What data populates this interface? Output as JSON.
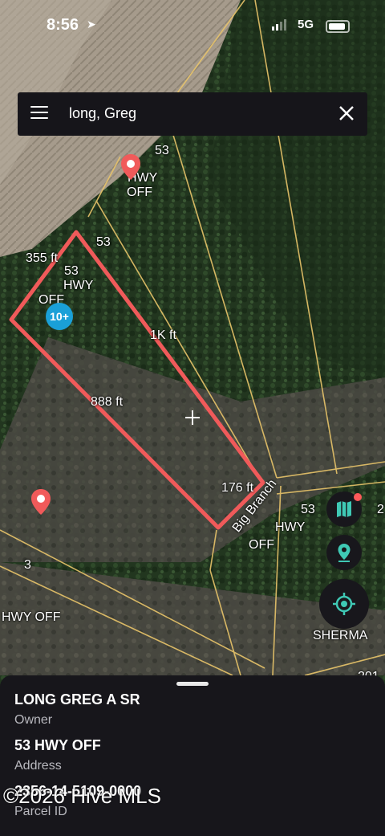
{
  "status_bar": {
    "time": "8:56",
    "network": "5G"
  },
  "search": {
    "query": "long, Greg"
  },
  "map": {
    "labels": {
      "lbl_53_top": "53",
      "lbl_hwy_top": "HWY",
      "lbl_off_top": "OFF",
      "lbl_53_mid": "53",
      "lbl_355ft": "355 ft",
      "lbl_53_parcel": "53",
      "lbl_hwy_parcel": "HWY",
      "lbl_off_parcel": "OFF",
      "lbl_1kft": "1K ft",
      "lbl_888ft": "888 ft",
      "lbl_176ft": "176 ft",
      "lbl_big_branch": "Big Branch",
      "lbl_53_right": "53",
      "lbl_2_right": "2",
      "lbl_hwy_right": "HWY",
      "lbl_off_right": "OFF",
      "lbl_3": "3",
      "lbl_hwy_off_left": "HWY OFF",
      "lbl_sherman": "SHERMA",
      "lbl_201": "201"
    },
    "cluster_count": "10+",
    "parcel_color": "#f05a5a",
    "boundary_color": "#e8c46a",
    "pin_color": "#f05a5a",
    "cluster_color": "#1aa0d8"
  },
  "sheet": {
    "owner_value": "LONG GREG A SR",
    "owner_label": "Owner",
    "address_value": "53 HWY OFF",
    "address_label": "Address",
    "parcel_value": "2356-14-5109-0000",
    "parcel_label": "Parcel ID"
  },
  "watermark": "©2026 Hive MLS"
}
